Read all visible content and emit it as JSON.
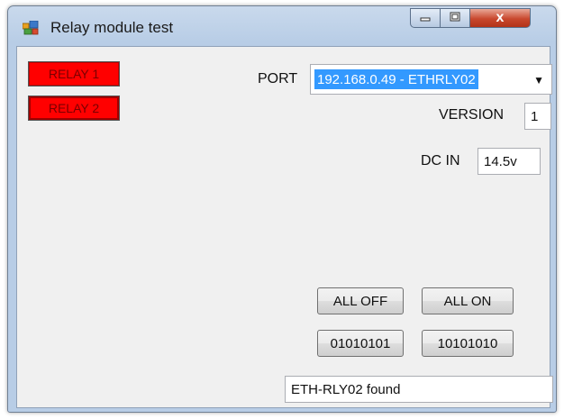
{
  "window": {
    "title": "Relay module test",
    "minimize_icon": "minimize-icon",
    "maximize_icon": "maximize-icon",
    "close_icon": "close-icon",
    "close_glyph": "x"
  },
  "relays": [
    {
      "label": "RELAY 1",
      "state": "off",
      "color": "#ff0000"
    },
    {
      "label": "RELAY 2",
      "state": "off",
      "color": "#ff0000"
    }
  ],
  "port": {
    "label": "PORT",
    "selected": "192.168.0.49 - ETHRLY02"
  },
  "version": {
    "label": "VERSION",
    "value": "1"
  },
  "dc_in": {
    "label": "DC IN",
    "value": "14.5v"
  },
  "buttons": {
    "all_off": "ALL OFF",
    "all_on": "ALL ON",
    "pattern_a": "01010101",
    "pattern_b": "10101010"
  },
  "status_text": "ETH-RLY02 found",
  "colors": {
    "selection": "#3399ff",
    "relay_off": "#ff0000",
    "close_button": "#c8472d"
  }
}
